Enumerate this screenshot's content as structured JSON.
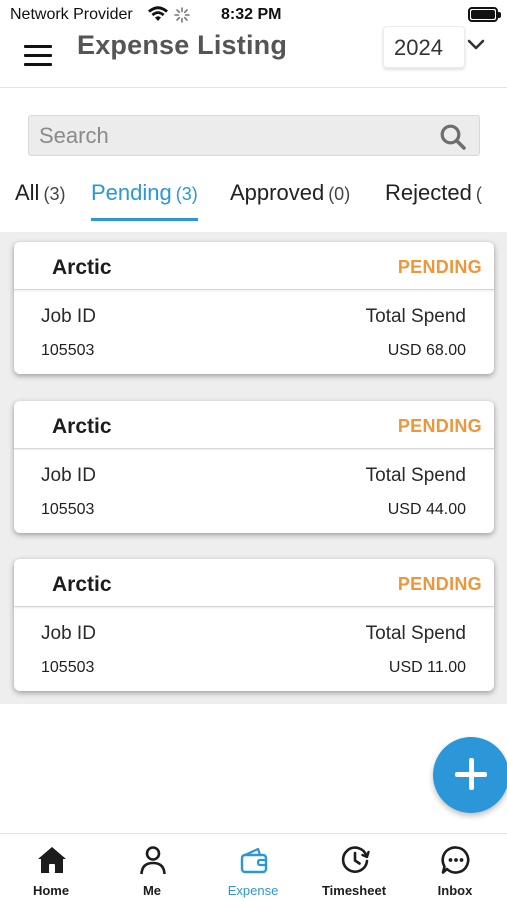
{
  "status_bar": {
    "provider": "Network Provider",
    "time": "8:32 PM"
  },
  "header": {
    "title": "Expense Listing",
    "year": "2024"
  },
  "search": {
    "placeholder": "Search"
  },
  "tabs": [
    {
      "label": "All",
      "count": "(3)"
    },
    {
      "label": "Pending",
      "count": "(3)"
    },
    {
      "label": "Approved",
      "count": "(0)"
    },
    {
      "label": "Rejected",
      "count": "("
    }
  ],
  "cards": [
    {
      "client": "Arctic",
      "status": "PENDING",
      "job_label": "Job ID",
      "job_id": "105503",
      "spend_label": "Total Spend",
      "amount": "USD 68.00"
    },
    {
      "client": "Arctic",
      "status": "PENDING",
      "job_label": "Job ID",
      "job_id": "105503",
      "spend_label": "Total Spend",
      "amount": "USD 44.00"
    },
    {
      "client": "Arctic",
      "status": "PENDING",
      "job_label": "Job ID",
      "job_id": "105503",
      "spend_label": "Total Spend",
      "amount": "USD 11.00"
    }
  ],
  "bottom_nav": [
    {
      "label": "Home",
      "icon": "home-icon"
    },
    {
      "label": "Me",
      "icon": "person-icon"
    },
    {
      "label": "Expense",
      "icon": "wallet-icon"
    },
    {
      "label": "Timesheet",
      "icon": "clock-icon"
    },
    {
      "label": "Inbox",
      "icon": "chat-icon"
    }
  ],
  "colors": {
    "accent": "#2b97d9",
    "pending": "#f0963a",
    "list_background": "#eeeeee"
  }
}
